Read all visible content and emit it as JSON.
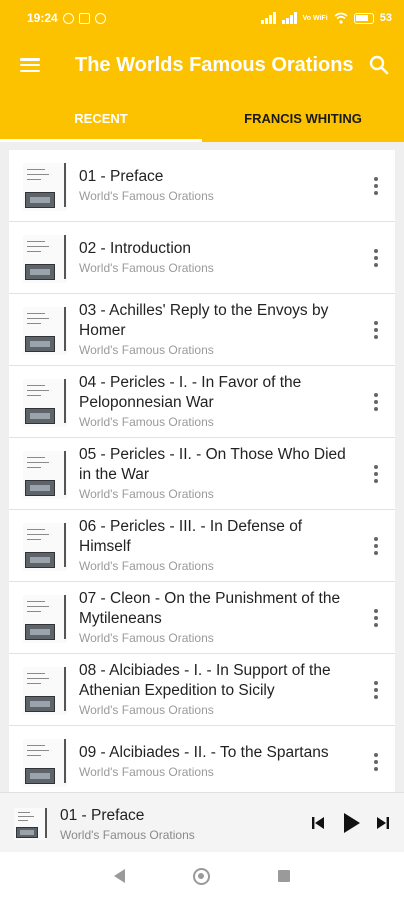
{
  "status_bar": {
    "time": "19:24",
    "network_label": "Vo WiFi",
    "battery": "53",
    "icons": [
      "whatsapp-icon",
      "briefcase-icon",
      "sync-icon",
      "signal-icon",
      "wifi-icon",
      "battery-charging-icon"
    ]
  },
  "app_bar": {
    "title": "The Worlds Famous Orations",
    "menu_icon": "hamburger-menu-icon",
    "search_icon": "search-icon"
  },
  "tabs": [
    {
      "label": "RECENT",
      "active": true
    },
    {
      "label": "FRANCIS WHITING",
      "active": false
    }
  ],
  "list": {
    "items": [
      {
        "title": "01 - Preface",
        "subtitle": "World's Famous Orations"
      },
      {
        "title": "02 - Introduction",
        "subtitle": "World's Famous Orations"
      },
      {
        "title": "03 - Achilles' Reply to the Envoys by Homer",
        "subtitle": "World's Famous Orations"
      },
      {
        "title": "04 - Pericles - I. - In Favor of the Peloponnesian War",
        "subtitle": "World's Famous Orations"
      },
      {
        "title": "05 - Pericles - II. - On Those Who Died in the War",
        "subtitle": "World's Famous Orations"
      },
      {
        "title": "06 - Pericles - III. - In Defense of Himself",
        "subtitle": "World's Famous Orations"
      },
      {
        "title": "07 - Cleon - On the Punishment of the Mytileneans",
        "subtitle": "World's Famous Orations"
      },
      {
        "title": "08 - Alcibiades - I. - In Support of the Athenian Expedition to Sicily",
        "subtitle": "World's Famous Orations"
      },
      {
        "title": "09 - Alcibiades - II. - To the Spartans",
        "subtitle": "World's Famous Orations"
      }
    ]
  },
  "player": {
    "title": "01 - Preface",
    "subtitle": "World's Famous Orations",
    "controls": [
      "skip-previous-icon",
      "play-icon",
      "skip-next-icon"
    ]
  },
  "nav_bar": {
    "icons": [
      "back-icon",
      "home-icon",
      "recents-icon"
    ]
  },
  "colors": {
    "primary": "#FCC200",
    "on_primary": "#FFFFFF",
    "text_primary": "#222222",
    "text_secondary": "#9A9A9A"
  }
}
